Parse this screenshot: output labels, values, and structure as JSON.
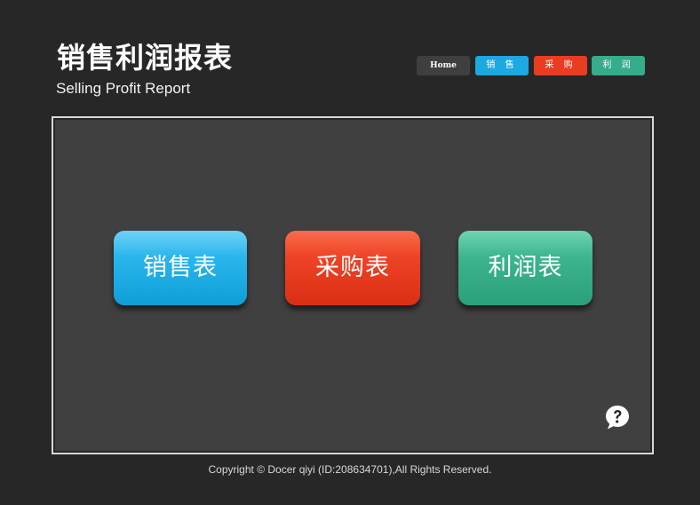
{
  "header": {
    "title": "销售利润报表",
    "subtitle": "Selling Profit Report"
  },
  "nav": {
    "home": "Home",
    "sales": "销 售",
    "purchase": "采 购",
    "profit": "利 润"
  },
  "main": {
    "sales_table": "销售表",
    "purchase_table": "采购表",
    "profit_table": "利润表",
    "help_icon": "question-bubble"
  },
  "footer": {
    "copyright": "Copyright © Docer qiyi (ID:208634701),All Rights Reserved."
  },
  "colors": {
    "background": "#272727",
    "panel": "#404040",
    "sales": "#1ca9e2",
    "purchase": "#ea3c21",
    "profit": "#35ac8a"
  }
}
